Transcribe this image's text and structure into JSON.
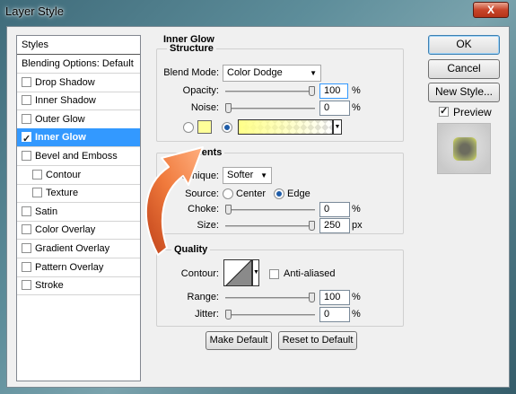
{
  "window": {
    "title": "Layer Style",
    "close_label": "X"
  },
  "styles_panel": {
    "header": "Styles",
    "items": [
      {
        "label": "Blending Options: Default",
        "checkbox": false,
        "checked": false,
        "selected": false,
        "sub": false
      },
      {
        "label": "Drop Shadow",
        "checkbox": true,
        "checked": false,
        "selected": false,
        "sub": false
      },
      {
        "label": "Inner Shadow",
        "checkbox": true,
        "checked": false,
        "selected": false,
        "sub": false
      },
      {
        "label": "Outer Glow",
        "checkbox": true,
        "checked": false,
        "selected": false,
        "sub": false
      },
      {
        "label": "Inner Glow",
        "checkbox": true,
        "checked": true,
        "selected": true,
        "sub": false
      },
      {
        "label": "Bevel and Emboss",
        "checkbox": true,
        "checked": false,
        "selected": false,
        "sub": false
      },
      {
        "label": "Contour",
        "checkbox": true,
        "checked": false,
        "selected": false,
        "sub": true
      },
      {
        "label": "Texture",
        "checkbox": true,
        "checked": false,
        "selected": false,
        "sub": true
      },
      {
        "label": "Satin",
        "checkbox": true,
        "checked": false,
        "selected": false,
        "sub": false
      },
      {
        "label": "Color Overlay",
        "checkbox": true,
        "checked": false,
        "selected": false,
        "sub": false
      },
      {
        "label": "Gradient Overlay",
        "checkbox": true,
        "checked": false,
        "selected": false,
        "sub": false
      },
      {
        "label": "Pattern Overlay",
        "checkbox": true,
        "checked": false,
        "selected": false,
        "sub": false
      },
      {
        "label": "Stroke",
        "checkbox": true,
        "checked": false,
        "selected": false,
        "sub": false
      }
    ]
  },
  "inner_glow": {
    "section_title": "Inner Glow",
    "structure": {
      "title": "Structure",
      "blend_mode_label": "Blend Mode:",
      "blend_mode_value": "Color Dodge",
      "opacity_label": "Opacity:",
      "opacity_value": "100",
      "opacity_percent": 100,
      "noise_label": "Noise:",
      "noise_value": "0",
      "noise_percent": 0,
      "percent": "%",
      "glow_color": "#ffff99",
      "gradient_start": "#ffff88"
    },
    "elements": {
      "title": "ments",
      "technique_label": "echnique:",
      "technique_value": "Softer",
      "source_label": "Source:",
      "source_center": "Center",
      "source_edge": "Edge",
      "choke_label": "Choke:",
      "choke_value": "0",
      "choke_percent": 0,
      "size_label": "Size:",
      "size_value": "250",
      "size_fraction": 1.0,
      "size_unit": "px",
      "percent": "%"
    },
    "quality": {
      "title": "Quality",
      "contour_label": "Contour:",
      "anti_aliased_label": "Anti-aliased",
      "range_label": "Range:",
      "range_value": "100",
      "range_percent": 100,
      "jitter_label": "Jitter:",
      "jitter_value": "0",
      "jitter_percent": 0,
      "percent": "%"
    },
    "make_default_label": "Make Default",
    "reset_default_label": "Reset to Default"
  },
  "buttons": {
    "ok": "OK",
    "cancel": "Cancel",
    "new_style": "New Style...",
    "preview": "Preview"
  },
  "colors": {
    "selection": "#3399ff",
    "arrow": "#e8642a"
  }
}
